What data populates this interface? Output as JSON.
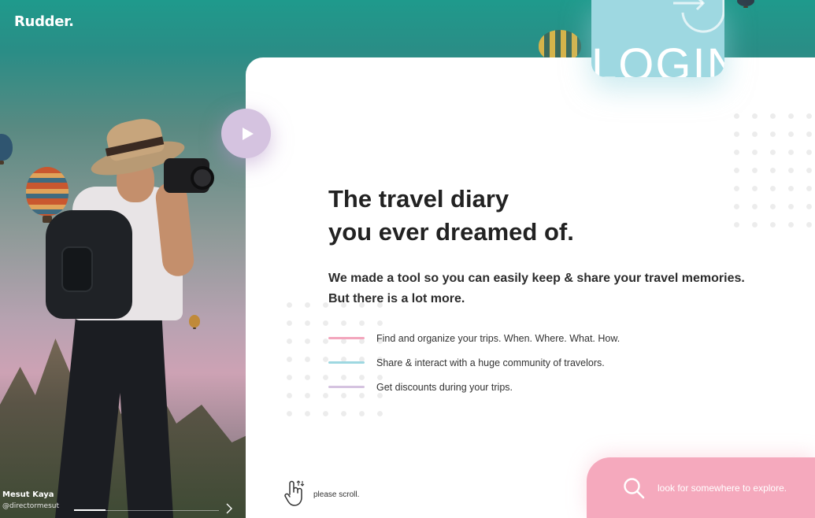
{
  "brand": {
    "name": "Rudder."
  },
  "hero": {
    "credit_name": "Mesut Kaya",
    "credit_handle": "@directormesut",
    "slide_progress": 0.22
  },
  "login": {
    "label": "LOGIN",
    "icon": "login-arrow-icon"
  },
  "play": {
    "icon": "play-icon",
    "color": "#d5c3e0"
  },
  "main": {
    "headline_line1": "The travel diary",
    "headline_line2": "you ever dreamed of.",
    "lead_line1": "We made a tool so you can easily keep & share your travel memories.",
    "lead_line2": "But there is a lot more.",
    "features": [
      {
        "text": "Find and organize your trips. When. Where. What. How.",
        "color": "#f3a6bd"
      },
      {
        "text": "Share & interact with a huge community of travelors.",
        "color": "#9ed8e1"
      },
      {
        "text": "Get discounts during your trips.",
        "color": "#d5c3e0"
      }
    ]
  },
  "scroll_hint": {
    "label": "please scroll.",
    "icon": "hand-scroll-icon"
  },
  "search": {
    "label": "look for somewhere to explore.",
    "icon": "search-icon",
    "color": "#f5a9bd"
  },
  "colors": {
    "accent_pink": "#f5a9bd",
    "accent_blue": "#9ed8e1",
    "accent_lilac": "#d5c3e0"
  }
}
